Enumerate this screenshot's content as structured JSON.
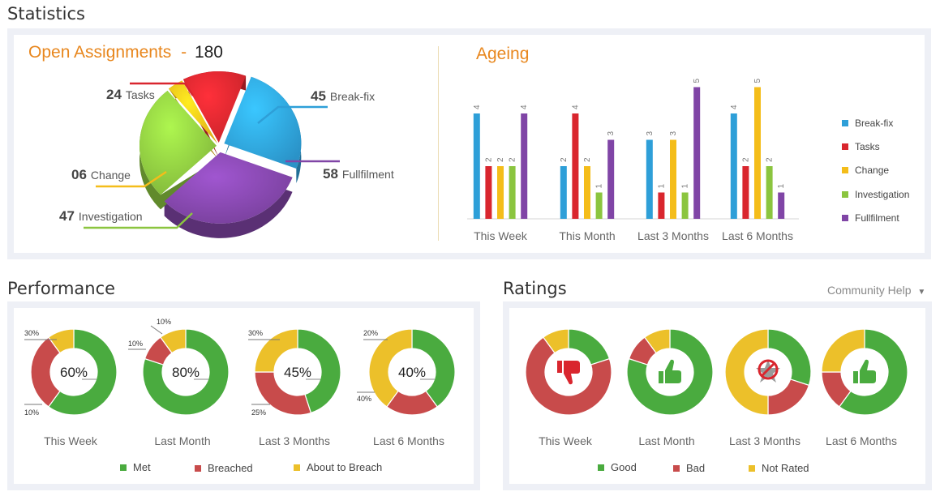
{
  "statistics_title": "Statistics",
  "performance_title": "Performance",
  "ratings_title": "Ratings",
  "community_help": "Community Help",
  "colors": {
    "breakfix": "#2e9fd8",
    "tasks": "#d9262e",
    "change": "#f4bd1a",
    "investigation": "#8bc53f",
    "fullfilment": "#8045a6",
    "met": "#4aab3f",
    "breached": "#c84b4b",
    "about": "#ecc02a"
  },
  "open_assignments": {
    "title": "Open Assignments",
    "dash": "-",
    "total": "180"
  },
  "pie_labels": {
    "tasks_value": "24",
    "tasks_label": "Tasks",
    "breakfix_value": "45",
    "breakfix_label": "Break-fix",
    "change_value": "06",
    "change_label": "Change",
    "fullfilment_value": "58",
    "fullfilment_label": "Fullfilment",
    "investigation_value": "47",
    "investigation_label": "Investigation"
  },
  "ageing_title": "Ageing",
  "ageing_legend": {
    "breakfix": "Break-fix",
    "tasks": "Tasks",
    "change": "Change",
    "investigation": "Investigation",
    "fullfilment": "Fullfilment"
  },
  "performance_legend": {
    "met": "Met",
    "breached": "Breached",
    "about": "About to Breach"
  },
  "ratings_legend": {
    "good": "Good",
    "bad": "Bad",
    "not_rated": "Not Rated"
  },
  "chart_data": [
    {
      "type": "pie",
      "title": "Open Assignments",
      "categories": [
        "Tasks",
        "Break-fix",
        "Change",
        "Fullfilment",
        "Investigation"
      ],
      "values": [
        24,
        45,
        6,
        58,
        47
      ]
    },
    {
      "type": "bar",
      "title": "Ageing",
      "categories": [
        "This Week",
        "This Month",
        "Last 3 Months",
        "Last 6 Months"
      ],
      "series": [
        {
          "name": "Break-fix",
          "values": [
            4,
            2,
            3,
            4
          ]
        },
        {
          "name": "Tasks",
          "values": [
            2,
            4,
            1,
            2
          ]
        },
        {
          "name": "Change",
          "values": [
            2,
            2,
            3,
            5
          ]
        },
        {
          "name": "Investigation",
          "values": [
            2,
            1,
            1,
            2
          ]
        },
        {
          "name": "Fullfilment",
          "values": [
            4,
            3,
            5,
            1
          ]
        }
      ],
      "legend": "right"
    },
    {
      "type": "pie",
      "title": "Performance",
      "categories": [
        "This Week",
        "Last Month",
        "Last 3 Months",
        "Last 6 Months"
      ],
      "series": [
        {
          "name": "Met",
          "values": [
            60,
            80,
            45,
            40
          ]
        },
        {
          "name": "Breached",
          "values": [
            30,
            10,
            30,
            20
          ]
        },
        {
          "name": "About to Breach",
          "values": [
            10,
            10,
            25,
            40
          ]
        }
      ],
      "center_labels": [
        "60%",
        "80%",
        "45%",
        "40%"
      ],
      "side_labels": [
        {
          "top": "30%",
          "bottom": "10%"
        },
        {
          "top": "10%",
          "mid": "10%"
        },
        {
          "top": "30%",
          "bottom": "25%"
        },
        {
          "top": "20%",
          "bottom": "40%"
        }
      ]
    },
    {
      "type": "pie",
      "title": "Ratings",
      "categories": [
        "This Week",
        "Last Month",
        "Last 3 Months",
        "Last 6 Months"
      ],
      "series": [
        {
          "name": "Good",
          "values": [
            20,
            80,
            30,
            60
          ]
        },
        {
          "name": "Bad",
          "values": [
            70,
            10,
            20,
            15
          ]
        },
        {
          "name": "Not Rated",
          "values": [
            10,
            10,
            50,
            25
          ]
        }
      ],
      "icons": [
        "thumbs-down-icon",
        "thumbs-up-icon",
        "no-rating-icon",
        "thumbs-up-icon"
      ]
    }
  ]
}
